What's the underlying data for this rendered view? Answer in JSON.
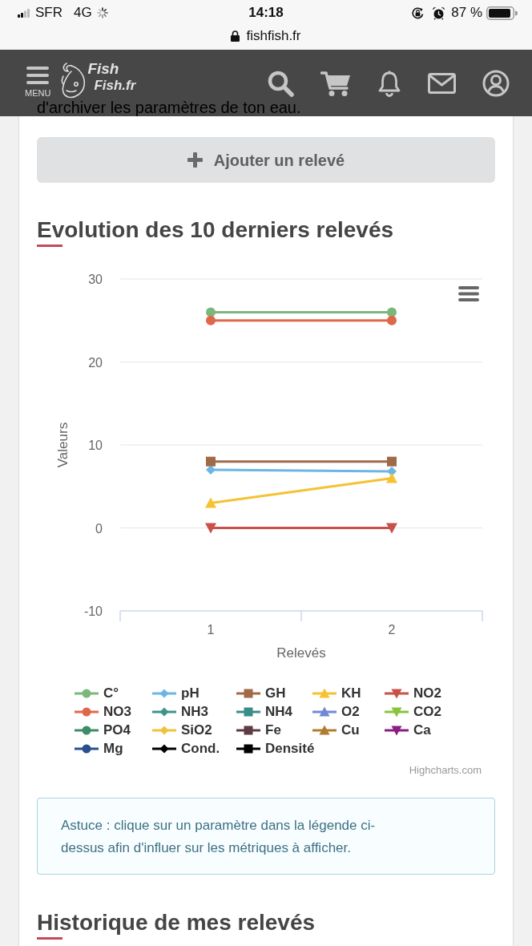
{
  "status_bar": {
    "carrier": "SFR",
    "network": "4G",
    "time": "14:18",
    "battery": "87 %"
  },
  "address_bar": {
    "url": "fishfish.fr"
  },
  "header": {
    "menu_label": "MENU",
    "logo": {
      "line_1": "Fish",
      "line_2": "Fish.fr"
    },
    "intro_text": "d'archiver les paramètres de ton eau."
  },
  "add_button": {
    "label": "Ajouter un relevé"
  },
  "chart_section": {
    "title": "Evolution des 10 derniers relevés",
    "chart_data": {
      "type": "line",
      "xlabel": "Relevés",
      "ylabel": "Valeurs",
      "categories": [
        "1",
        "2"
      ],
      "ylim": [
        -10,
        30
      ],
      "yticks": [
        -10,
        0,
        10,
        20,
        30
      ],
      "grid": true,
      "legend": "bottom",
      "series": [
        {
          "name": "C°",
          "color": "#7cb87c",
          "marker": "circle",
          "values": [
            26,
            26
          ]
        },
        {
          "name": "pH",
          "color": "#6cb5e6",
          "marker": "diamond",
          "values": [
            7,
            6.8
          ]
        },
        {
          "name": "GH",
          "color": "#a06a48",
          "marker": "square",
          "values": [
            8,
            8
          ]
        },
        {
          "name": "KH",
          "color": "#f5c232",
          "marker": "triangle",
          "values": [
            3,
            6
          ]
        },
        {
          "name": "NO2",
          "color": "#c8514a",
          "marker": "triangle-down",
          "values": [
            0,
            0
          ]
        },
        {
          "name": "NO3",
          "color": "#e0684a",
          "marker": "circle",
          "values": [
            25,
            25
          ]
        },
        {
          "name": "NH3",
          "color": "#3d9488",
          "marker": "diamond",
          "values": [
            null,
            null
          ]
        },
        {
          "name": "NH4",
          "color": "#3a8c88",
          "marker": "square",
          "values": [
            null,
            null
          ]
        },
        {
          "name": "O2",
          "color": "#7188d6",
          "marker": "triangle",
          "values": [
            null,
            null
          ]
        },
        {
          "name": "CO2",
          "color": "#8ac43e",
          "marker": "triangle-down",
          "values": [
            null,
            null
          ]
        },
        {
          "name": "PO4",
          "color": "#3e8c68",
          "marker": "circle",
          "values": [
            null,
            null
          ]
        },
        {
          "name": "SiO2",
          "color": "#f0c23e",
          "marker": "diamond",
          "values": [
            null,
            null
          ]
        },
        {
          "name": "Fe",
          "color": "#5e3a42",
          "marker": "square",
          "values": [
            null,
            null
          ]
        },
        {
          "name": "Cu",
          "color": "#b07c30",
          "marker": "triangle",
          "values": [
            null,
            null
          ]
        },
        {
          "name": "Ca",
          "color": "#8a1e82",
          "marker": "triangle-down",
          "values": [
            null,
            null
          ]
        },
        {
          "name": "Mg",
          "color": "#2a4f8f",
          "marker": "circle",
          "values": [
            null,
            null
          ]
        },
        {
          "name": "Cond.",
          "color": "#000000",
          "marker": "diamond",
          "values": [
            null,
            null
          ]
        },
        {
          "name": "Densité",
          "color": "#000000",
          "marker": "square",
          "values": [
            null,
            null
          ]
        }
      ]
    },
    "credit": "Highcharts.com"
  },
  "tip": {
    "text": "Astuce : clique sur un paramètre dans la légende ci-dessus afin d'influer sur les métriques à afficher."
  },
  "history_section": {
    "title": "Historique de mes relevés"
  }
}
